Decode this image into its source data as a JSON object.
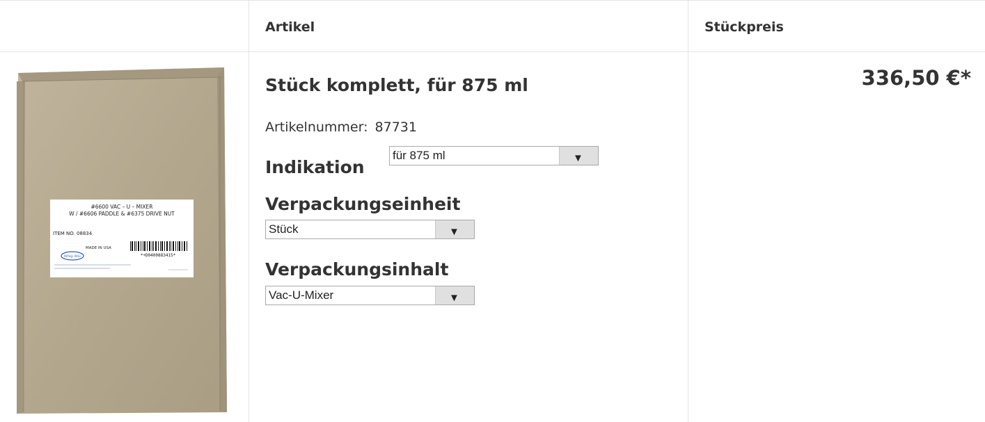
{
  "table": {
    "headers": {
      "article": "Artikel",
      "unit_price": "Stückpreis"
    }
  },
  "product": {
    "title": "Stück komplett, für 875 ml",
    "article_number_label": "Artikelnummer:",
    "article_number": "87731",
    "price": "336,50 €*",
    "image": {
      "label_line1": "#6600 VAC – U – MIXER",
      "label_line2": "W / #6606 PADDLE & #6375 DRIVE NUT",
      "item_no": "ITEM NO. 08834",
      "made_in": "MADE IN USA",
      "barcode_text": "*+D0400883415*",
      "logo": "Whip Mix"
    },
    "options": {
      "indikation": {
        "label": "Indikation",
        "value": "für 875 ml"
      },
      "verpackungseinheit": {
        "label": "Verpackungseinheit",
        "value": "Stück"
      },
      "verpackungsinhalt": {
        "label": "Verpackungsinhalt",
        "value": "Vac-U-Mixer"
      }
    }
  },
  "colors": {
    "border": "#e4e4e4",
    "text": "#333333",
    "cardboard": "#b4a890"
  }
}
